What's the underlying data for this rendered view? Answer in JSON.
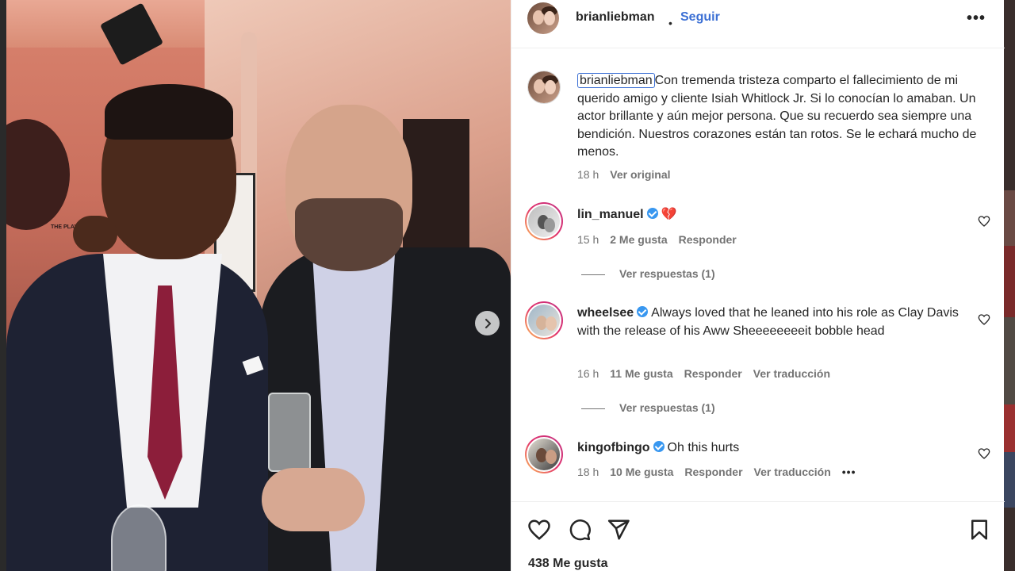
{
  "post": {
    "username": "brianliebman",
    "follow_label": "Seguir",
    "separator": "•",
    "more_label": "•••",
    "caption_username": "brianliebman",
    "caption_text": "Con tremenda tristeza comparto el fallecimiento de mi querido amigo y cliente Isiah Whitlock Jr. Si lo conocían lo amaban. Un actor brillante y aún mejor persona. Que su recuerdo sea siempre una bendición. Nuestros corazones están tan rotos. Se le echará mucho de menos.",
    "caption_time": "18 h",
    "caption_translate": "Ver original",
    "likes_label": "438 Me gusta"
  },
  "photo": {
    "banner_text": "THE PLAY TRIBUN"
  },
  "comments": [
    {
      "username": "lin_manuel",
      "verified": true,
      "text": "💔",
      "time": "15 h",
      "likes": "2 Me gusta",
      "reply": "Responder",
      "translate": "",
      "view_replies": "Ver respuestas (1)"
    },
    {
      "username": "wheelsee",
      "verified": true,
      "text": "Always loved that he leaned into his role as Clay Davis with the release of his Aww Sheeeeeeeeit bobble head",
      "time": "16 h",
      "likes": "11 Me gusta",
      "reply": "Responder",
      "translate": "Ver traducción",
      "view_replies": "Ver respuestas (1)"
    },
    {
      "username": "kingofbingo",
      "verified": true,
      "text": "Oh this hurts",
      "time": "18 h",
      "likes": "10 Me gusta",
      "reply": "Responder",
      "translate": "Ver traducción",
      "more": "•••"
    }
  ],
  "icons": {
    "like": "heart-icon",
    "comment": "comment-bubble-icon",
    "share": "paper-plane-icon",
    "save": "bookmark-icon",
    "next": "chevron-right-icon",
    "options": "more-horizontal-icon",
    "verified": "verified-badge-icon"
  },
  "colors": {
    "link_blue": "#3b6fd4",
    "verified_blue": "#3897f0",
    "muted_text": "#737373",
    "text": "#262626",
    "story_ring": "#e1306c"
  }
}
